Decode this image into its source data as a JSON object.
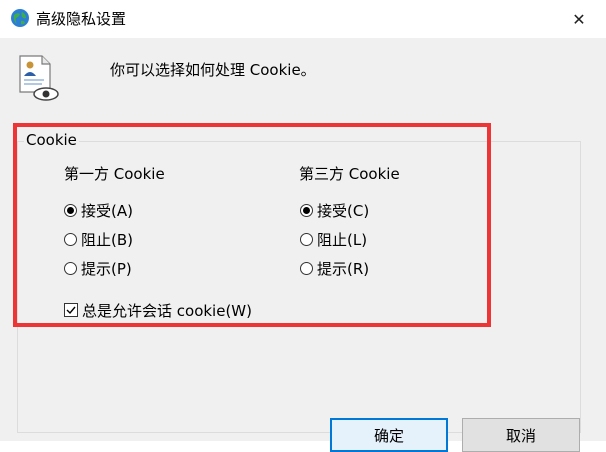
{
  "window": {
    "title": "高级隐私设置",
    "close_glyph": "✕"
  },
  "header": {
    "description": "你可以选择如何处理 Cookie。"
  },
  "group": {
    "legend": "Cookie",
    "highlight_color": "#ee3535"
  },
  "first_party": {
    "title": "第一方 Cookie",
    "options": [
      {
        "label": "接受(A)",
        "checked": true
      },
      {
        "label": "阻止(B)",
        "checked": false
      },
      {
        "label": "提示(P)",
        "checked": false
      }
    ]
  },
  "third_party": {
    "title": "第三方 Cookie",
    "options": [
      {
        "label": "接受(C)",
        "checked": true
      },
      {
        "label": "阻止(L)",
        "checked": false
      },
      {
        "label": "提示(R)",
        "checked": false
      }
    ]
  },
  "session": {
    "label": "总是允许会话 cookie(W)",
    "checked": true
  },
  "buttons": {
    "ok": "确定",
    "cancel": "取消"
  }
}
